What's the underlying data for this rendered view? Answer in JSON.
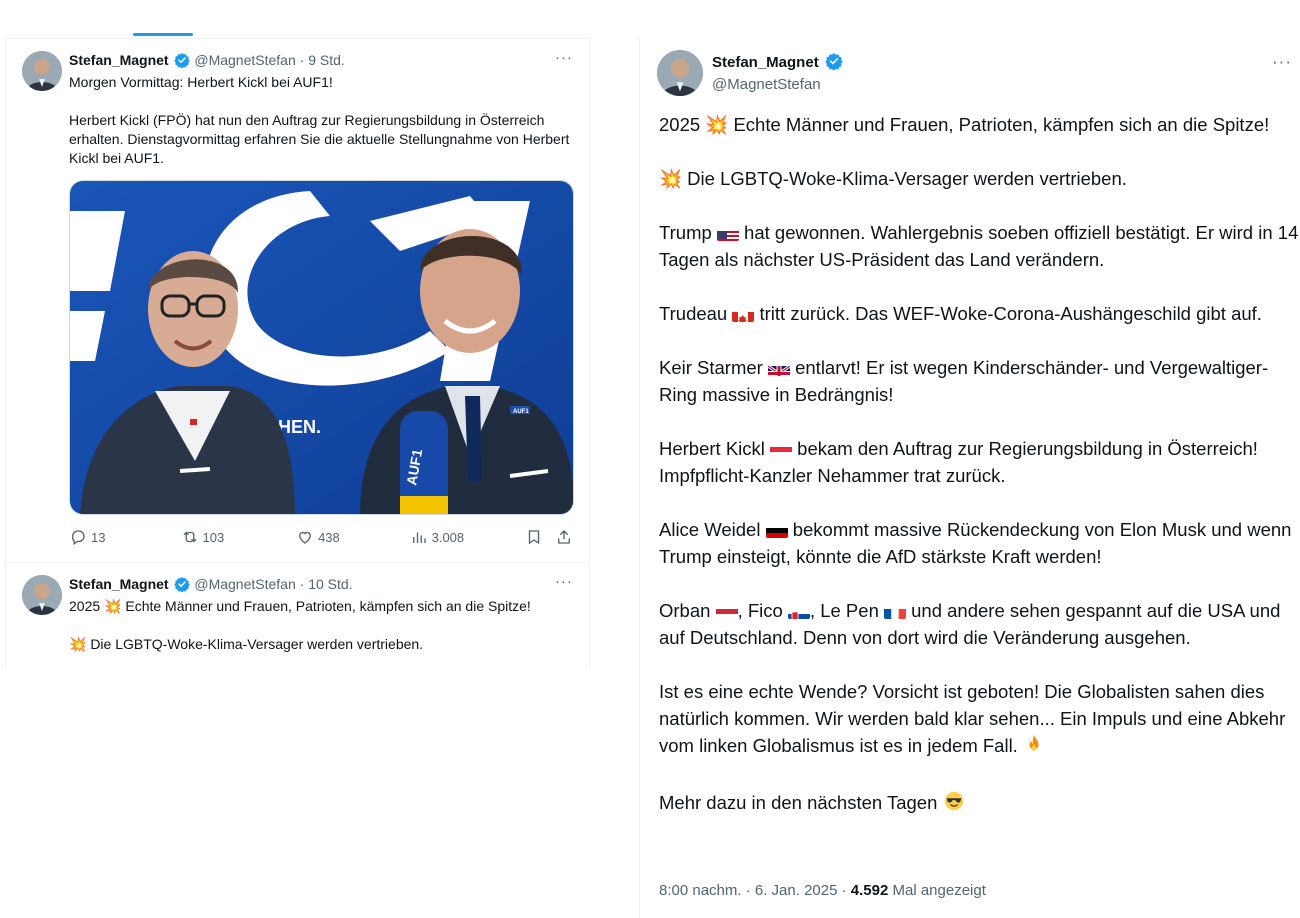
{
  "left_feed": {
    "tweets": [
      {
        "name": "Stefan_Magnet",
        "handle": "@MagnetStefan",
        "sep": " · ",
        "time": "9 Std.",
        "more": "···",
        "text": "Morgen Vormittag: Herbert Kickl bei AUF1!\n\nHerbert Kickl (FPÖ) hat nun den Auftrag zur Regierungsbildung in Österreich erhalten. Dienstagvormittag erfahren Sie die aktuelle Stellungnahme von Herbert Kickl bei AUF1.",
        "media": {
          "backdrop_text": "EHEN.",
          "mic_text": "AUF1",
          "pin_text": "AUF1"
        },
        "stats": {
          "replies": "13",
          "reposts": "103",
          "likes": "438",
          "views": "3.008"
        }
      },
      {
        "name": "Stefan_Magnet",
        "handle": "@MagnetStefan",
        "sep": " · ",
        "time": "10 Std.",
        "more": "···",
        "line1": "2025 💥 Echte Männer und Frauen, Patrioten, kämpfen sich an die Spitze!",
        "line2": "💥 Die LGBTQ-Woke-Klima-Versager werden vertrieben."
      }
    ]
  },
  "detail": {
    "name": "Stefan_Magnet",
    "handle": "@MagnetStefan",
    "more": "···",
    "p1": "2025 💥 Echte Männer und Frauen, Patrioten, kämpfen sich an die Spitze!",
    "p2": "💥 Die LGBTQ-Woke-Klima-Versager werden vertrieben.",
    "p3_a": "Trump",
    "p3_b": "hat gewonnen. Wahlergebnis soeben offiziell bestätigt. Er wird in 14 Tagen als nächster US-Präsident das Land verändern.",
    "p4_a": "Trudeau",
    "p4_b": "tritt zurück. Das WEF-Woke-Corona-Aushängeschild gibt auf.",
    "p5_a": "Keir Starmer",
    "p5_b": "entlarvt! Er ist wegen Kinderschänder- und Vergewaltiger-Ring massive in Bedrängnis!",
    "p6_a": "Herbert Kickl",
    "p6_b": "bekam den Auftrag zur Regierungsbildung in Österreich! Impfpflicht-Kanzler Nehammer trat zurück.",
    "p7_a": "Alice Weidel",
    "p7_b": "bekommt massive Rückendeckung von Elon Musk und wenn Trump einsteigt, könnte die AfD stärkste Kraft werden!",
    "p8_a": "Orban",
    "p8_b": ", Fico",
    "p8_c": ", Le Pen",
    "p8_d": "und andere sehen gespannt auf die USA und auf Deutschland. Denn von dort wird die Veränderung ausgehen.",
    "p9": "Ist es eine echte Wende? Vorsicht ist geboten! Die Globalisten sahen dies natürlich kommen. Wir werden bald klar sehen... Ein Impuls und eine Abkehr vom linken Globalismus ist es in jedem Fall.",
    "p10": "Mehr dazu in den nächsten Tagen",
    "meta_time": "8:00 nachm. · 6. Jan. 2025 · ",
    "meta_views": "4.592",
    "meta_views_label": " Mal angezeigt"
  },
  "colors": {
    "accent": "#1d9bf0",
    "muted": "#536471",
    "border": "#eff3f4"
  },
  "icons": [
    "verified-badge-icon",
    "more-icon",
    "reply-icon",
    "repost-icon",
    "like-icon",
    "views-icon",
    "bookmark-icon",
    "share-icon"
  ]
}
